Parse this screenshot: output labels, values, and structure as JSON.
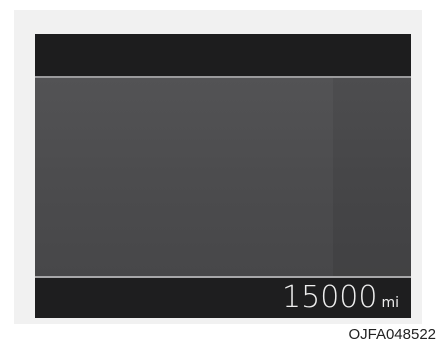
{
  "odometer": {
    "value": "15000",
    "unit": "mi"
  },
  "caption": "OJFA048522",
  "colors": {
    "screen_bar": "#1d1d1e",
    "screen_main": "#4a4a4c",
    "text": "#eeeeee"
  }
}
